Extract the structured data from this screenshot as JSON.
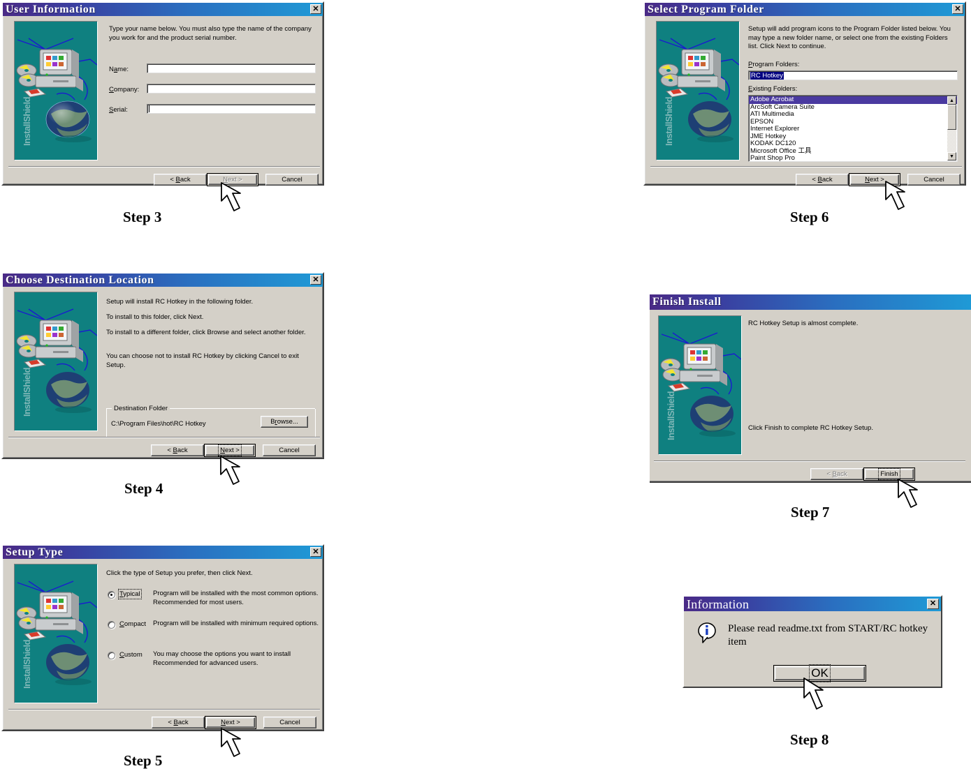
{
  "page": {
    "title": "RC Hotkey InstallShield setup steps 3-8"
  },
  "common": {
    "back_label": "< Back",
    "next_label": "Next >",
    "cancel_label": "Cancel",
    "close_glyph": "✕",
    "installshield_brand": "InstallShield"
  },
  "steps": {
    "step3": "Step 3",
    "step4": "Step 4",
    "step5": "Step 5",
    "step6": "Step 6",
    "step7": "Step 7",
    "step8": "Step 8"
  },
  "dialog_user_information": {
    "title": "User Information",
    "intro": "Type your name below. You must also type the name of the company you work for and the product serial number.",
    "fields": [
      {
        "label": "Name:",
        "label_pre": "N",
        "label_accel": "a",
        "label_post": "me:",
        "value": "",
        "has_caret": false
      },
      {
        "label": "Company:",
        "label_pre": "",
        "label_accel": "C",
        "label_post": "ompany:",
        "value": "",
        "has_caret": false
      },
      {
        "label": "Serial:",
        "label_pre": "",
        "label_accel": "S",
        "label_post": "erial:",
        "value": "",
        "has_caret": true
      }
    ],
    "buttons": {
      "back": "< Back",
      "next": "Next >",
      "cancel": "Cancel",
      "next_state": "disabled"
    }
  },
  "dialog_choose_destination": {
    "title": "Choose Destination Location",
    "paragraphs": [
      "Setup will install RC Hotkey in the following folder.",
      "To install to this folder, click Next.",
      "To install to a different folder, click Browse and select another folder.",
      "You can choose not to install RC Hotkey by clicking Cancel to exit Setup."
    ],
    "group_title": "Destination Folder",
    "path": "C:\\Program Files\\hot\\RC Hotkey",
    "browse_label": "Browse...",
    "buttons": {
      "back": "< Back",
      "next": "Next >",
      "cancel": "Cancel",
      "next_state": "default-focused"
    }
  },
  "dialog_setup_type": {
    "title": "Setup Type",
    "intro": "Click the type of Setup you prefer, then click Next.",
    "options": [
      {
        "label": "Typical",
        "accel": "T",
        "rest": "ypical",
        "selected": true,
        "focused": true,
        "desc": "Program will be installed with the most common options.  Recommended for most users."
      },
      {
        "label": "Compact",
        "accel": "C",
        "rest": "ompact",
        "selected": false,
        "focused": false,
        "desc": "Program will be installed with minimum required options."
      },
      {
        "label": "Custom",
        "accel": "C",
        "rest": "ustom",
        "selected": false,
        "focused": false,
        "desc": "You may choose the options you want to install Recommended for advanced users."
      }
    ],
    "buttons": {
      "back": "< Back",
      "next": "Next >",
      "cancel": "Cancel",
      "next_state": "default"
    }
  },
  "dialog_select_program_folder": {
    "title": "Select Program Folder",
    "intro": "Setup will add program icons to the Program Folder listed below. You may type a new folder name, or select one from the existing Folders list.  Click Next to continue.",
    "program_folders_label": "Program Folders:",
    "program_folders_accel": "P",
    "program_folders_value": "RC Hotkey",
    "existing_folders_label": "Existing Folders:",
    "existing_folders_accel": "E",
    "existing_folders": [
      "Adobe Acrobat",
      "ArcSoft Camera Suite",
      "ATI Multimedia",
      "EPSON",
      "Internet Explorer",
      "JME Hotkey",
      "KODAK DC120",
      "Microsoft Office 工具",
      "Paint Shop Pro"
    ],
    "selected_index": 0,
    "scroll_up_glyph": "▲",
    "scroll_down_glyph": "▼",
    "buttons": {
      "back": "< Back",
      "next": "Next >",
      "cancel": "Cancel",
      "next_state": "default"
    }
  },
  "dialog_finish_install": {
    "title": "Finish Install",
    "line1": "RC Hotkey Setup is almost complete.",
    "line2": "Click Finish to complete RC Hotkey Setup.",
    "buttons": {
      "back": "< Back",
      "finish": "Finish",
      "back_state": "disabled",
      "finish_state": "default-focused"
    }
  },
  "dialog_information": {
    "title": "Information",
    "message": "Please read readme.txt from START/RC hotkey item",
    "ok_label": "OK",
    "icon": "information-icon",
    "close_glyph": "✕"
  },
  "colors": {
    "title_gradient_start": "#4a2a86",
    "title_gradient_end": "#1f9ad6",
    "dialog_face": "#d4d0c8",
    "art_background": "#0f8080",
    "list_selection": "#4a3aa0",
    "field_selection": "#000080"
  }
}
